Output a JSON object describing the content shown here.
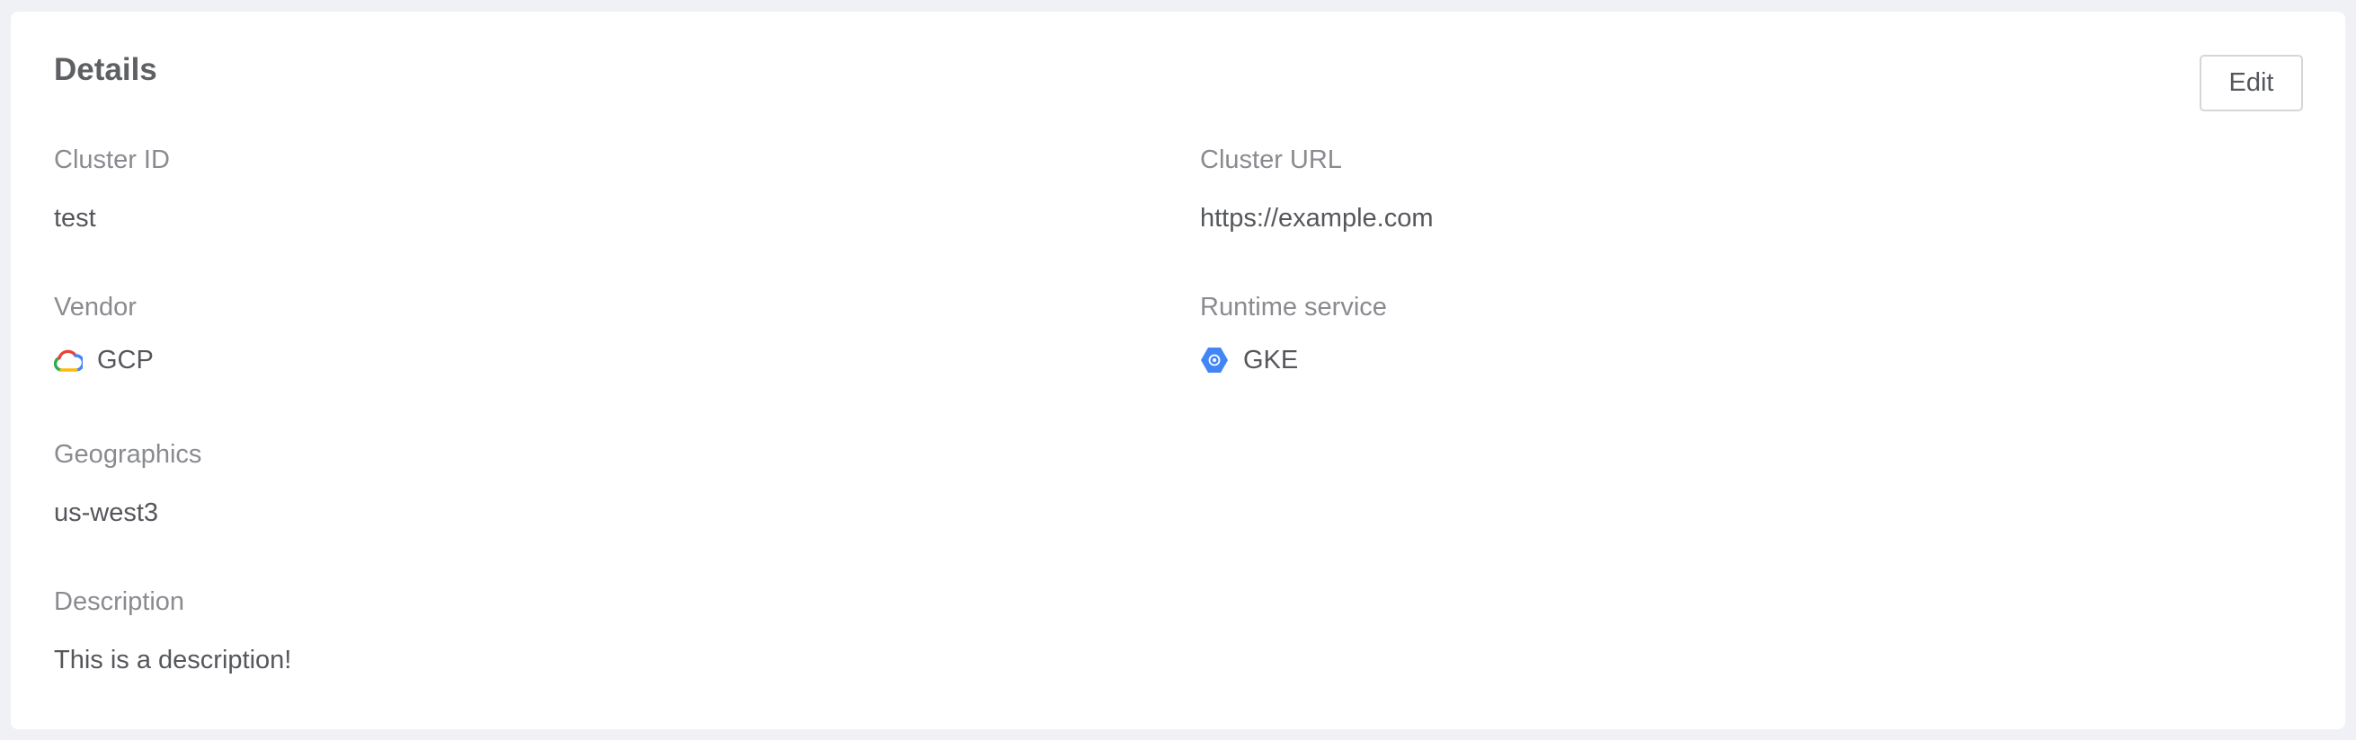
{
  "card": {
    "title": "Details",
    "edit_label": "Edit"
  },
  "fields": {
    "cluster_id": {
      "label": "Cluster ID",
      "value": "test"
    },
    "cluster_url": {
      "label": "Cluster URL",
      "value": "https://example.com"
    },
    "vendor": {
      "label": "Vendor",
      "value": "GCP",
      "icon": "gcp-cloud-icon"
    },
    "runtime_service": {
      "label": "Runtime service",
      "value": "GKE",
      "icon": "gke-hexagon-icon"
    },
    "geographics": {
      "label": "Geographics",
      "value": "us-west3"
    },
    "description": {
      "label": "Description",
      "value": "This is a description!"
    }
  },
  "colors": {
    "page_background": "#f0f1f4",
    "card_background": "#ffffff",
    "label_text": "#8a8b90",
    "value_text": "#55575c",
    "gke_blue": "#4285f4"
  }
}
